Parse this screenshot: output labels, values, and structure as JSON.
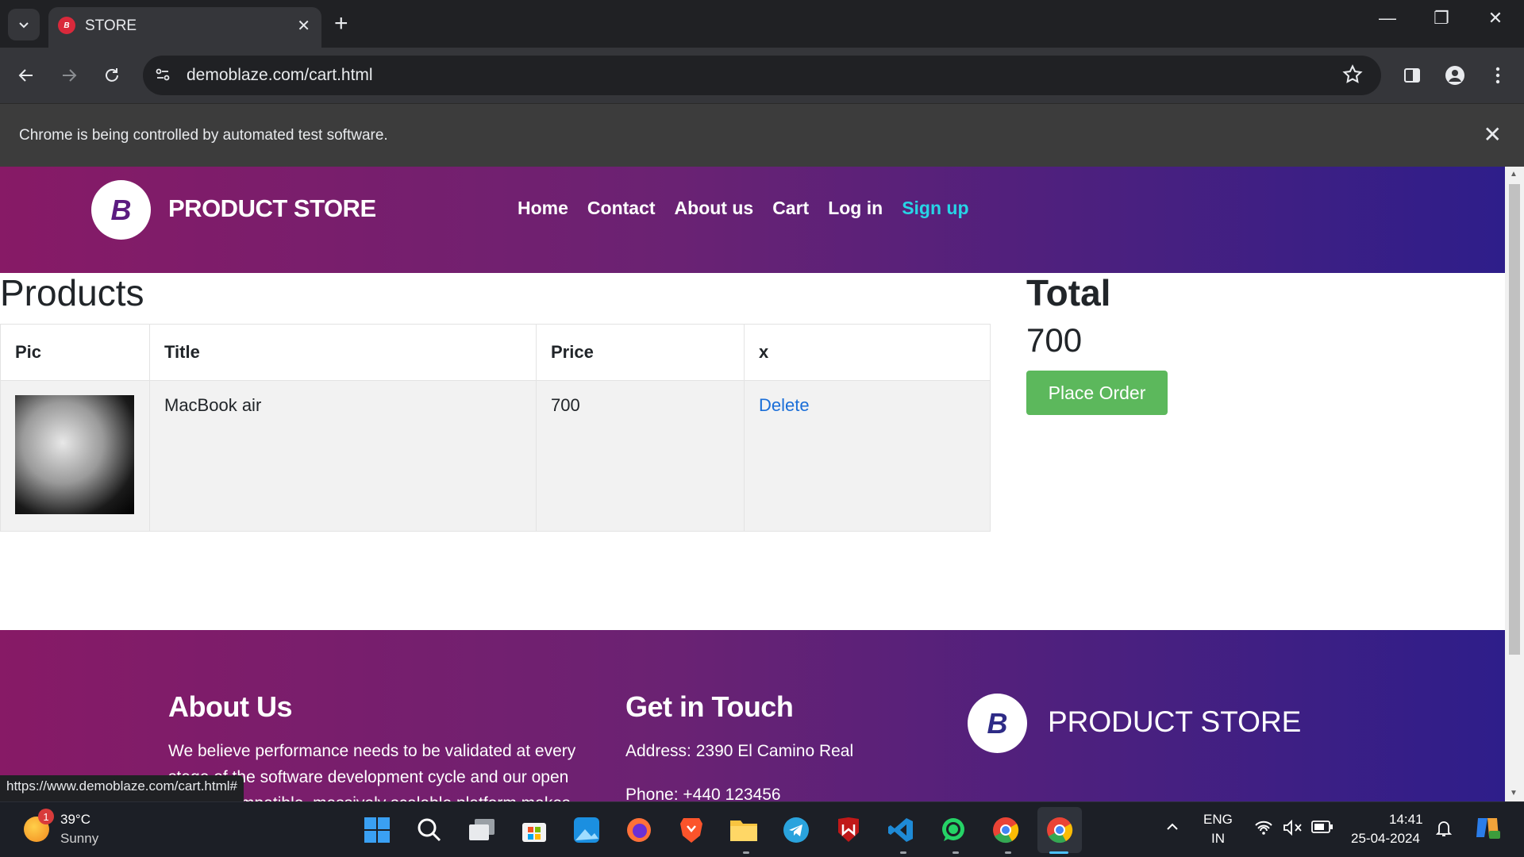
{
  "browser": {
    "tab_title": "STORE",
    "tab_favicon_text": "B",
    "url": "demoblaze.com/cart.html",
    "infobar_text": "Chrome is being controlled by automated test software.",
    "status_url": "https://www.demoblaze.com/cart.html#"
  },
  "site": {
    "brand_logo": "B",
    "brand_name": "PRODUCT STORE",
    "nav": [
      "Home",
      "Contact",
      "About us",
      "Cart",
      "Log in",
      "Sign up"
    ]
  },
  "cart": {
    "heading": "Products",
    "columns": [
      "Pic",
      "Title",
      "Price",
      "x"
    ],
    "rows": [
      {
        "title": "MacBook air",
        "price": "700",
        "action": "Delete"
      }
    ],
    "total_heading": "Total",
    "total_value": "700",
    "place_order_label": "Place Order"
  },
  "footer": {
    "about_heading": "About Us",
    "about_text_1": "We believe performance needs to be validated at every",
    "about_text_2": "stage of the software development cycle and our open",
    "about_text_3": "source compatible, massively scalable platform makes",
    "contact_heading": "Get in Touch",
    "address": "Address: 2390 El Camino Real",
    "phone": "Phone: +440 123456",
    "brand_logo": "B",
    "brand_name": "PRODUCT STORE"
  },
  "taskbar": {
    "weather_badge": "1",
    "temperature": "39°C",
    "condition": "Sunny",
    "lang_1": "ENG",
    "lang_2": "IN",
    "time": "14:41",
    "date": "25-04-2024",
    "apps": [
      "windows-start",
      "search",
      "task-view",
      "microsoft-store",
      "photos",
      "firefox",
      "brave",
      "file-explorer",
      "telegram",
      "mcafee",
      "vscode",
      "whatsapp",
      "chrome-profile",
      "chrome"
    ]
  },
  "colors": {
    "nav_gradient_start": "#871a66",
    "nav_gradient_end": "#2e1e8a",
    "signup_link": "#27d4e6",
    "place_order": "#5cb85c",
    "delete_link": "#1a6ed8"
  }
}
